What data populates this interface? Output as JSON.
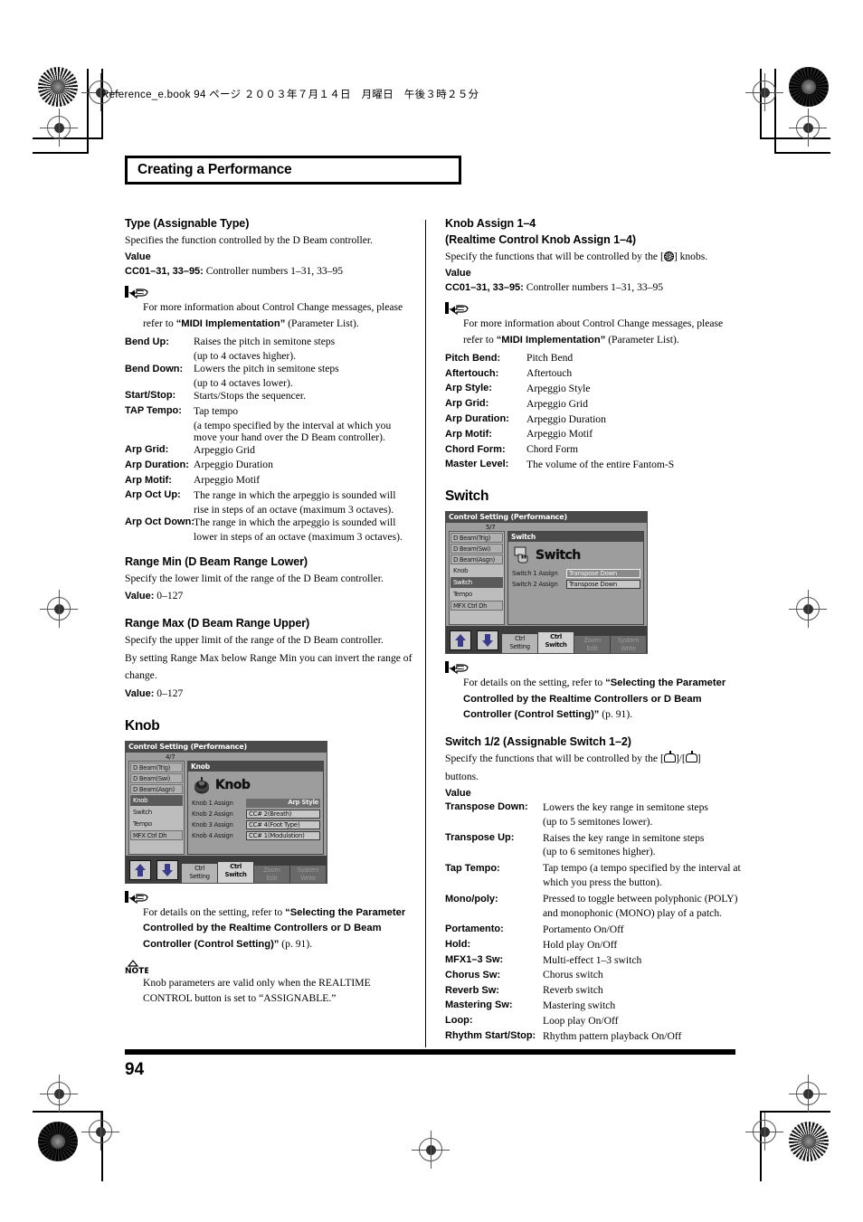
{
  "header": {
    "book_line": "Reference_e.book 94 ページ ２００３年７月１４日　月曜日　午後３時２５分",
    "chapter_title": "Creating a Performance"
  },
  "footer": {
    "page_number": "94"
  },
  "left_column": {
    "section_type": {
      "heading": "Type (Assignable Type)",
      "intro": "Specifies the function controlled by the D Beam controller.",
      "value_label": "Value",
      "value_line_bold": "CC01–31, 33–95:",
      "value_line_rest": " Controller numbers 1–31, 33–95",
      "note": {
        "lead": "For more information about Control Change messages, please refer to ",
        "bold": "“MIDI Implementation”",
        "tail": " (Parameter List)."
      },
      "entries": [
        {
          "term": "Bend Up:",
          "def": "Raises the pitch in semitone steps",
          "cont": "(up to 4 octaves higher)."
        },
        {
          "term": "Bend Down:",
          "def": "Lowers the pitch in semitone steps",
          "cont": "(up to 4 octaves lower)."
        },
        {
          "term": "Start/Stop:",
          "def": "Starts/Stops the sequencer.",
          "cont": ""
        },
        {
          "term": "TAP Tempo:",
          "def": "Tap tempo",
          "cont": "(a tempo specified by the interval at which you",
          "cont2": "move your hand over the D Beam controller)."
        },
        {
          "term": "Arp Grid:",
          "def": "Arpeggio Grid",
          "cont": ""
        },
        {
          "term": "Arp Duration:",
          "def": "Arpeggio Duration",
          "cont": ""
        },
        {
          "term": "Arp Motif:",
          "def": "Arpeggio Motif",
          "cont": ""
        },
        {
          "term": "Arp Oct Up:",
          "def": "The range in which the arpeggio is sounded will",
          "cont": "rise in steps of an octave (maximum 3 octaves)."
        },
        {
          "term": "Arp Oct Down:",
          "def": "The range in which the arpeggio is sounded will",
          "cont": "lower in steps of an octave (maximum 3 octaves)."
        }
      ]
    },
    "section_range_min": {
      "heading": "Range Min (D Beam Range Lower)",
      "body": "Specify the lower limit of the range of the D Beam controller.",
      "value_bold": "Value:",
      "value_rest": " 0–127"
    },
    "section_range_max": {
      "heading": "Range Max (D Beam Range Upper)",
      "body_line1": "Specify the upper limit of the range of the D Beam controller.",
      "body_line2": "By setting Range Max below Range Min you can invert the range of",
      "body_line3": "change.",
      "value_bold": "Value:",
      "value_rest": " 0–127"
    },
    "section_knob": {
      "heading": "Knob",
      "lcd": {
        "titlebar": "Control Setting (Performance)",
        "page_indicator": "4/7",
        "sidebar_items": [
          "D Beam(Trig)",
          "D Beam(Swi)",
          "D Beam(Asgn)",
          "Knob",
          "Switch",
          "Tempo",
          "MFX Ctrl Dh"
        ],
        "sidebar_selected": "Knob",
        "main_title": "Knob",
        "big_label": "Knob",
        "param_rows": [
          {
            "name": "Knob 1 Assign",
            "value": "Arp Style",
            "is_header_value": true
          },
          {
            "name": "Knob 2 Assign",
            "value": "CC# 2(Breath)",
            "is_header_value": false
          },
          {
            "name": "Knob 3 Assign",
            "value": "CC# 4(Foot Type)",
            "is_header_value": false
          },
          {
            "name": "Knob 4 Assign",
            "value": "CC# 1(Modulation)",
            "is_header_value": false
          }
        ],
        "footer_buttons": [
          {
            "label_l1": "Ctrl",
            "label_l2": "Setting",
            "state": "mid"
          },
          {
            "label_l1": "Ctrl",
            "label_l2": "Switch",
            "state": "active"
          },
          {
            "label_l1": "Zoom",
            "label_l2": "Edit",
            "state": "dim"
          },
          {
            "label_l1": "System",
            "label_l2": "Write",
            "state": "dim"
          }
        ]
      },
      "note": {
        "lead": "For details on the setting, refer to ",
        "bold": "“Selecting the Parameter Controlled by the Realtime Controllers or D Beam Controller (Control Setting)”",
        "tail": " (p. 91)."
      },
      "note2": {
        "line1": "Knob parameters are valid only when the REALTIME",
        "line2": "CONTROL button is set to “ASSIGNABLE.”"
      }
    }
  },
  "right_column": {
    "section_knob_assign": {
      "heading_line1": "Knob Assign 1–4",
      "heading_line2": "(Realtime Control Knob Assign 1–4)",
      "intro_pre": "Specify the functions that will be controlled by the [",
      "intro_post": "] knobs.",
      "value_label": "Value",
      "value_line_bold": "CC01–31, 33–95:",
      "value_line_rest": " Controller numbers 1–31, 33–95",
      "note": {
        "lead": "For more information about Control Change messages, please refer to ",
        "bold": "“MIDI Implementation”",
        "tail": " (Parameter List)."
      },
      "entries": [
        {
          "term": "Pitch Bend:",
          "def": "Pitch Bend"
        },
        {
          "term": "Aftertouch:",
          "def": "Aftertouch"
        },
        {
          "term": "Arp Style:",
          "def": "Arpeggio Style"
        },
        {
          "term": "Arp Grid:",
          "def": "Arpeggio Grid"
        },
        {
          "term": "Arp Duration:",
          "def": "Arpeggio Duration"
        },
        {
          "term": "Arp Motif:",
          "def": "Arpeggio Motif"
        },
        {
          "term": "Chord Form:",
          "def": "Chord Form"
        },
        {
          "term": "Master Level:",
          "def": "The volume of the entire Fantom-S"
        }
      ]
    },
    "section_switch": {
      "heading": "Switch",
      "lcd": {
        "titlebar": "Control Setting (Performance)",
        "page_indicator": "5/7",
        "sidebar_items": [
          "D Beam(Trig)",
          "D Beam(Swi)",
          "D Beam(Asgn)",
          "Knob",
          "Switch",
          "Tempo",
          "MFX Ctrl Dh"
        ],
        "sidebar_selected": "Switch",
        "main_title": "Switch",
        "big_label": "Switch",
        "param_rows": [
          {
            "name": "Switch 1 Assign",
            "value": "Transpose Down",
            "is_header_value": true
          },
          {
            "name": "Switch 2 Assign",
            "value": "Transpose Down",
            "is_header_value": false
          }
        ],
        "footer_buttons": [
          {
            "label_l1": "Ctrl",
            "label_l2": "Setting",
            "state": "mid"
          },
          {
            "label_l1": "Ctrl",
            "label_l2": "Switch",
            "state": "active"
          },
          {
            "label_l1": "Zoom",
            "label_l2": "Edit",
            "state": "dim"
          },
          {
            "label_l1": "System",
            "label_l2": "Write",
            "state": "dim"
          }
        ]
      },
      "note": {
        "lead": "For details on the setting, refer to ",
        "bold": "“Selecting the Parameter Controlled by the Realtime Controllers or D Beam Controller (Control Setting)”",
        "tail": " (p. 91)."
      }
    },
    "section_switch12": {
      "heading": "Switch 1/2 (Assignable Switch 1–2)",
      "intro_pre": "Specify the functions that will be controlled by the [",
      "intro_mid": "]/[",
      "intro_post": "]",
      "intro_line2": "buttons.",
      "value_label": "Value",
      "entries": [
        {
          "term": "Transpose Down:",
          "def": "Lowers the key range in semitone steps",
          "cont": "(up to 5 semitones lower)."
        },
        {
          "term": "Transpose Up:",
          "def": "Raises the key range in semitone steps",
          "cont": "(up to 6 semitones higher)."
        },
        {
          "term": "Tap Tempo:",
          "def": "Tap tempo (a tempo specified by the interval at",
          "cont": "which you press the button)."
        },
        {
          "term": "Mono/poly:",
          "def": "Pressed to toggle between polyphonic (POLY)",
          "cont": "and monophonic (MONO) play of a patch."
        },
        {
          "term": "Portamento:",
          "def": "Portamento On/Off",
          "cont": ""
        },
        {
          "term": "Hold:",
          "def": "Hold play On/Off",
          "cont": ""
        },
        {
          "term": "MFX1–3 Sw:",
          "def": "Multi-effect 1–3 switch",
          "cont": ""
        },
        {
          "term": "Chorus Sw:",
          "def": "Chorus switch",
          "cont": ""
        },
        {
          "term": "Reverb Sw:",
          "def": "Reverb switch",
          "cont": ""
        },
        {
          "term": "Mastering Sw:",
          "def": "Mastering switch",
          "cont": ""
        },
        {
          "term": "Loop:",
          "def": "Loop play On/Off",
          "cont": ""
        },
        {
          "term": "Rhythm Start/Stop:",
          "def": "Rhythm pattern playback On/Off",
          "cont": ""
        }
      ]
    }
  }
}
